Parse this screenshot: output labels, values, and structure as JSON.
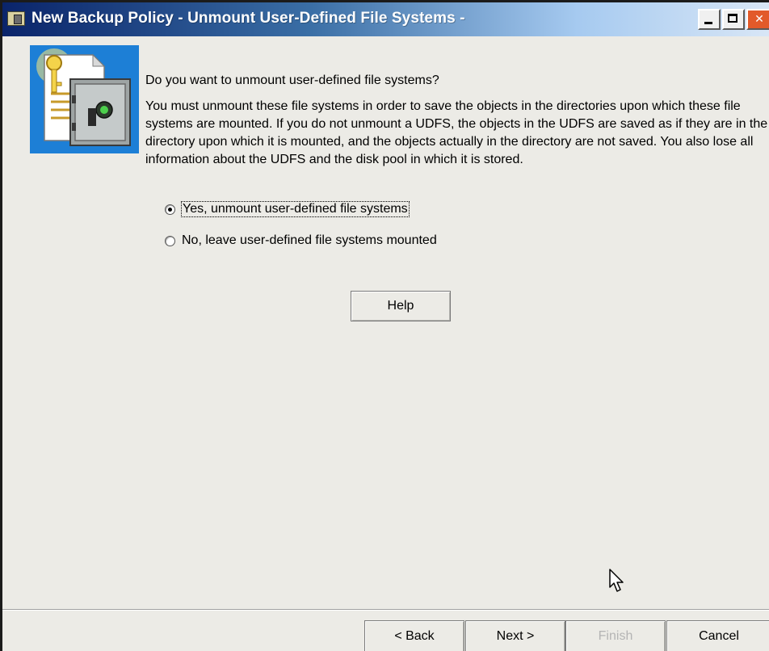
{
  "window": {
    "title": "New Backup Policy - Unmount User-Defined File Systems -"
  },
  "content": {
    "question": "Do you want to unmount user-defined file systems?",
    "description": "You must unmount these file systems in order to save the objects in the directories upon which these file systems are mounted. If you do not unmount a UDFS, the objects in the UDFS are saved as if they are in the directory upon which it is mounted, and the objects actually in the directory are not saved. You also lose all information about the UDFS and the disk pool in which it is stored.",
    "options": [
      {
        "label": "Yes, unmount user-defined file systems",
        "selected": true
      },
      {
        "label": "No, leave user-defined file systems mounted",
        "selected": false
      }
    ],
    "help_label": "Help"
  },
  "footer": {
    "back_label": "< Back",
    "next_label": "Next >",
    "finish_label": "Finish",
    "cancel_label": "Cancel",
    "finish_enabled": false
  },
  "icons": {
    "title": "backup-policy-icon",
    "wizard": "safe-document-icon",
    "cursor": "mouse-pointer-icon"
  },
  "colors": {
    "window_background": "#ecebe6",
    "titlebar_start": "#0a246a",
    "wizard_icon_background": "#1d7fd6",
    "disabled_text": "#b4b4b4"
  }
}
